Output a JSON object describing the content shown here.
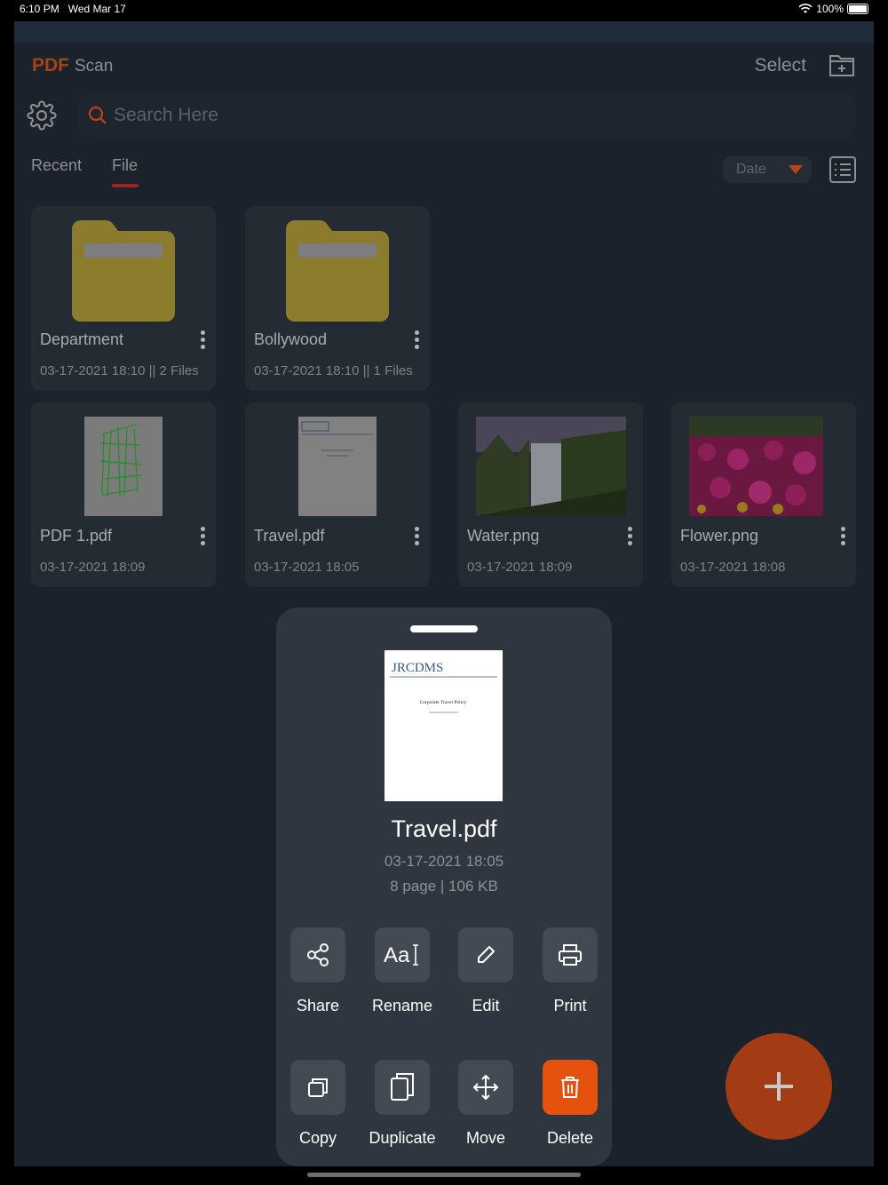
{
  "status": {
    "time": "6:10 PM",
    "date": "Wed Mar 17",
    "battery": "100%"
  },
  "header": {
    "logo_pdf": "PDF",
    "logo_scan": "Scan",
    "select_label": "Select"
  },
  "search": {
    "placeholder": "Search Here"
  },
  "tabs": {
    "recent": "Recent",
    "file": "File"
  },
  "sort": {
    "label": "Date"
  },
  "folders": [
    {
      "name": "Department",
      "meta": "03-17-2021 18:10 || 2 Files"
    },
    {
      "name": "Bollywood",
      "meta": "03-17-2021 18:10 || 1 Files"
    }
  ],
  "files": [
    {
      "name": "PDF 1.pdf",
      "meta": "03-17-2021 18:09"
    },
    {
      "name": "Travel.pdf",
      "meta": "03-17-2021 18:05"
    },
    {
      "name": "Water.png",
      "meta": "03-17-2021 18:09"
    },
    {
      "name": "Flower.png",
      "meta": "03-17-2021 18:08"
    }
  ],
  "sheet": {
    "title": "Travel.pdf",
    "date": "03-17-2021 18:05",
    "info": "8 page | 106 KB",
    "preview_logo": "JRCDMS",
    "preview_heading": "Corporate Travel Policy",
    "actions": [
      {
        "label": "Share",
        "icon": "share-icon"
      },
      {
        "label": "Rename",
        "icon": "rename-icon"
      },
      {
        "label": "Edit",
        "icon": "pencil-icon"
      },
      {
        "label": "Print",
        "icon": "printer-icon"
      },
      {
        "label": "Copy",
        "icon": "copy-icon"
      },
      {
        "label": "Duplicate",
        "icon": "duplicate-icon"
      },
      {
        "label": "Move",
        "icon": "move-icon"
      },
      {
        "label": "Delete",
        "icon": "trash-icon"
      }
    ]
  },
  "colors": {
    "accent": "#a0441b",
    "delete": "#e5520e",
    "fab": "#a33c14",
    "underline": "#a1231d"
  }
}
